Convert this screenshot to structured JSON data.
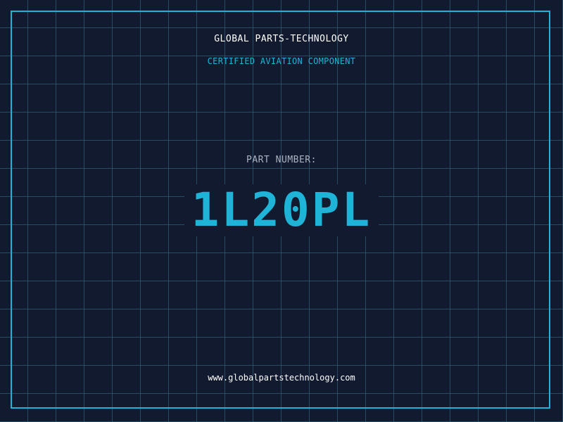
{
  "header": {
    "brand": "GLOBAL PARTS-TECHNOLOGY",
    "subtitle": "CERTIFIED AVIATION COMPONENT"
  },
  "main": {
    "label": "PART NUMBER:",
    "part_number": "1L20PL"
  },
  "footer": {
    "url": "www.globalpartstechnology.com"
  },
  "colors": {
    "background": "#111a2e",
    "accent": "#1fb3d8",
    "grid": "#287896",
    "text": "#ffffff",
    "muted": "#aab4c2"
  }
}
